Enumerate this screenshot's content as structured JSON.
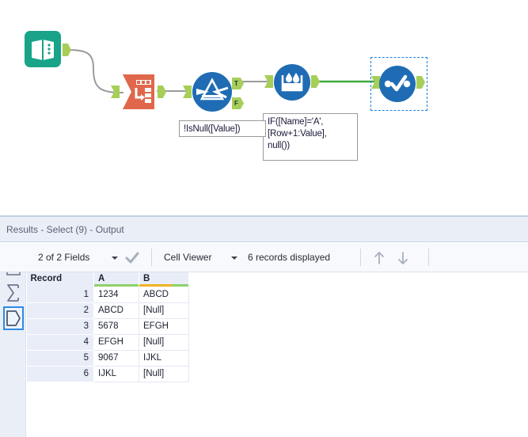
{
  "workflow": {
    "nodes": [
      {
        "id": "text-input",
        "icon": "book-icon",
        "tool": "Text Input"
      },
      {
        "id": "transpose",
        "icon": "transpose-icon",
        "tool": "Transpose"
      },
      {
        "id": "filter",
        "icon": "filter-funnel-icon",
        "tool": "Filter"
      },
      {
        "id": "multi-row-formula",
        "icon": "multi-row-formula-icon",
        "tool": "Multi-Row Formula"
      },
      {
        "id": "select",
        "icon": "select-check-icon",
        "tool": "Select",
        "selected": true
      }
    ],
    "anchor_labels": {
      "true": "T",
      "false": "F"
    },
    "annotations": [
      {
        "id": "filter-annotation",
        "text": "!IsNull([Value])"
      },
      {
        "id": "formula-annotation",
        "text": "IF([Name]='A',\n[Row+1:Value],\nnull())"
      }
    ],
    "colors": {
      "text_input": "#19a389",
      "transpose": "#e0674b",
      "blue_tool": "#1f6cb4",
      "anchor": "#a6ce58",
      "connection": "#9b9b9b",
      "connection_active": "#3faa3f",
      "selection": "#1a7fe0"
    }
  },
  "results": {
    "title": "Results - Select (9) - Output",
    "toolbar": {
      "fields_label": "2 of 2 Fields",
      "check_icon": "check-icon",
      "view_label": "Cell Viewer",
      "records_label": "6 records displayed",
      "up_icon": "arrow-up-icon",
      "down_icon": "arrow-down-icon"
    },
    "rail": [
      {
        "id": "records-view",
        "icon": "rows-icon",
        "selected": false
      },
      {
        "id": "summary-view",
        "icon": "sigma-icon",
        "selected": false
      },
      {
        "id": "metadata-view",
        "icon": "pentagon-data-icon",
        "selected": true
      }
    ],
    "table": {
      "columns": [
        {
          "key": "record",
          "label": "Record",
          "bar": []
        },
        {
          "key": "A",
          "label": "A",
          "bar": [
            {
              "color": "#8ed16b",
              "pct": 100
            }
          ]
        },
        {
          "key": "B",
          "label": "B",
          "bar": [
            {
              "color": "#f0b323",
              "pct": 66
            },
            {
              "color": "#8ed16b",
              "pct": 34
            }
          ]
        }
      ],
      "rows": [
        {
          "record": "1",
          "A": "1234",
          "B": "ABCD",
          "B_null": false
        },
        {
          "record": "2",
          "A": "ABCD",
          "B": "[Null]",
          "B_null": true
        },
        {
          "record": "3",
          "A": "5678",
          "B": "EFGH",
          "B_null": false
        },
        {
          "record": "4",
          "A": "EFGH",
          "B": "[Null]",
          "B_null": true
        },
        {
          "record": "5",
          "A": "9067",
          "B": "IJKL",
          "B_null": false
        },
        {
          "record": "6",
          "A": "IJKL",
          "B": "[Null]",
          "B_null": true
        }
      ]
    }
  }
}
